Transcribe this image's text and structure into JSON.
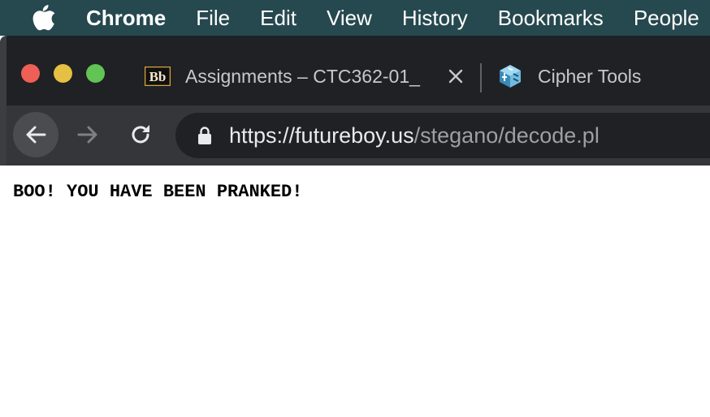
{
  "menubar": {
    "app_name": "Chrome",
    "items": [
      "File",
      "Edit",
      "View",
      "History",
      "Bookmarks",
      "People"
    ]
  },
  "tabs": [
    {
      "title": "Assignments – CTC362-01_",
      "icon": "blackboard-icon"
    },
    {
      "title": "Cipher Tools",
      "icon": "cipher-cube-icon"
    }
  ],
  "address_bar": {
    "scheme": "https://",
    "host": "futureboy.us",
    "path": "/stegano/decode.pl"
  },
  "page": {
    "message": "BOO! YOU HAVE BEEN PRANKED!"
  },
  "colors": {
    "menubar_bg": "#26484f",
    "tabstrip_bg": "#202124",
    "toolbar_bg": "#35363a",
    "close_light": "#ee5f56",
    "minimize_light": "#e5c042",
    "zoom_light": "#61c454"
  }
}
